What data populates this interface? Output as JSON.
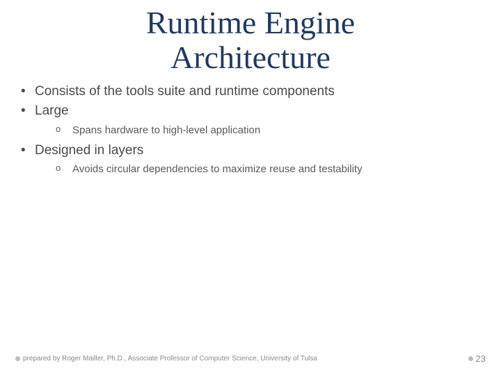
{
  "title_line1": "Runtime Engine",
  "title_line2": "Architecture",
  "bullets": {
    "b0": "Consists of the tools suite and runtime components",
    "b1": "Large",
    "b1_sub0": "Spans hardware to high-level application",
    "b2": "Designed in layers",
    "b2_sub0": "Avoids circular dependencies to maximize reuse and testability"
  },
  "footer": {
    "credit": "prepared by Roger Mailler, Ph.D., Associate Professor of Computer Science, University of Tulsa",
    "page": "23"
  }
}
